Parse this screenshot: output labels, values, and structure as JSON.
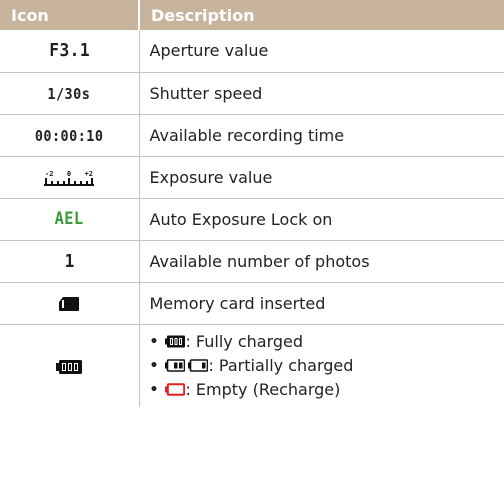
{
  "table": {
    "header": {
      "icon": "Icon",
      "description": "Description"
    },
    "rows": [
      {
        "icon_text": "F3.1",
        "description": "Aperture value"
      },
      {
        "icon_text": "1/30s",
        "description": "Shutter speed"
      },
      {
        "icon_text": "00:00:10",
        "description": "Available recording time"
      },
      {
        "icon_name": "exposure-scale-icon",
        "description": "Exposure value"
      },
      {
        "icon_text": "AEL",
        "description": "Auto Exposure Lock on"
      },
      {
        "icon_text": "1",
        "description": "Available number of photos"
      },
      {
        "icon_name": "memory-card-icon",
        "description": "Memory card inserted"
      },
      {
        "icon_name": "battery-full-icon",
        "battery_states": [
          {
            "icon_names": [
              "battery-full-icon"
            ],
            "text": ": Fully charged"
          },
          {
            "icon_names": [
              "battery-two-thirds-icon",
              "battery-one-third-icon"
            ],
            "text": ": Partially charged"
          },
          {
            "icon_names": [
              "battery-empty-icon"
            ],
            "text": ": Empty (Recharge)"
          }
        ]
      }
    ]
  },
  "exposure_scale": {
    "left": "-2",
    "center": "0",
    "right": "+2"
  },
  "colors": {
    "header": "#c8b49c",
    "ael_green": "#3a9a3a",
    "battery_empty": "#e02020"
  }
}
